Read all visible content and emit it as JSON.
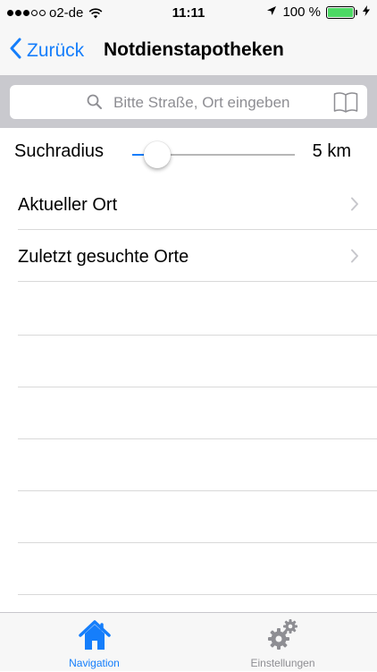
{
  "status_bar": {
    "carrier": "o2-de",
    "signal_bars_filled": 3,
    "signal_bars_total": 5,
    "time": "11:11",
    "battery": "100 %",
    "icons": [
      "wifi-icon",
      "location-arrow-icon",
      "battery-icon",
      "charging-bolt-icon"
    ]
  },
  "nav": {
    "back_label": "Zurück",
    "title": "Notdienstapotheken"
  },
  "search": {
    "placeholder": "Bitte Straße, Ort eingeben",
    "value": ""
  },
  "radius": {
    "label": "Suchradius",
    "value": "5 km",
    "slider_fraction": 0.0
  },
  "list": {
    "items": [
      {
        "label": "Aktueller Ort"
      },
      {
        "label": "Zuletzt gesuchte Orte"
      }
    ]
  },
  "tabs": [
    {
      "label": "Navigation",
      "icon": "home-icon",
      "selected": true
    },
    {
      "label": "Einstellungen",
      "icon": "gears-icon",
      "selected": false
    }
  ],
  "colors": {
    "accent": "#157efb",
    "inactive": "#8e8e93",
    "battery_fill": "#4cd964",
    "search_bar_bg": "#c9c9ce"
  }
}
